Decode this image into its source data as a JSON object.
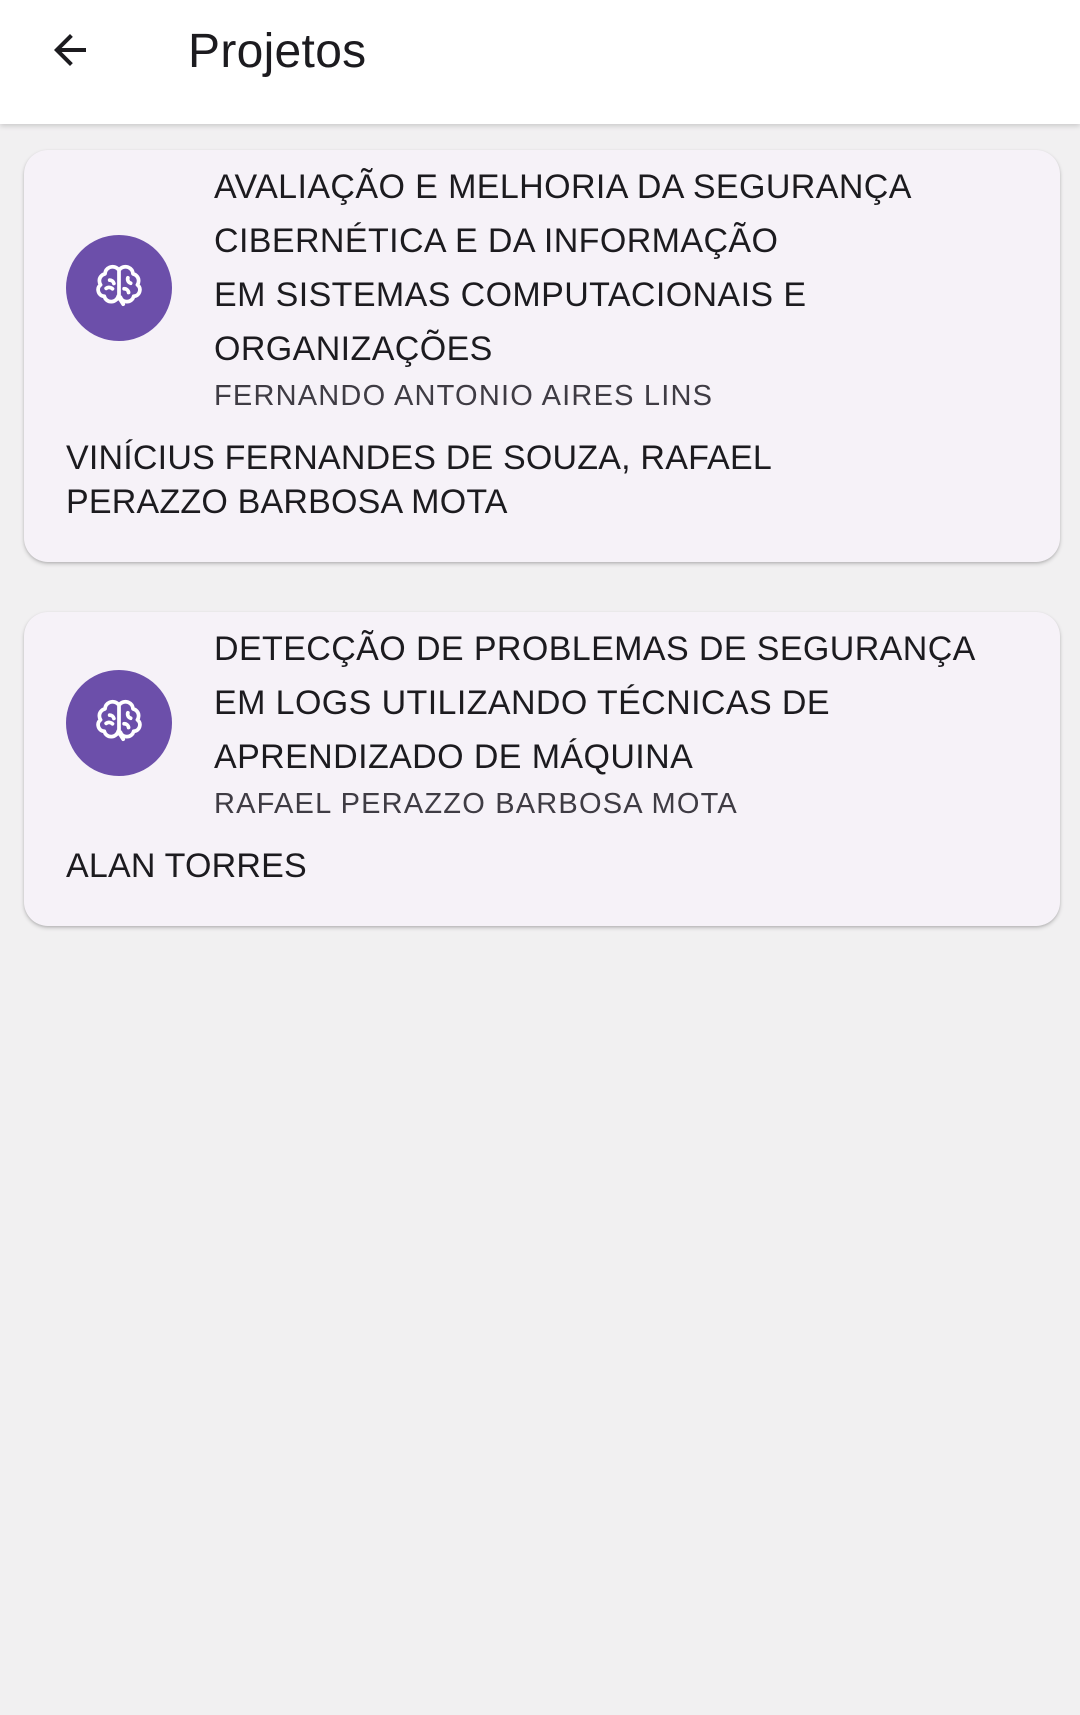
{
  "appbar": {
    "back_icon": "arrow-left-icon",
    "title": "Projetos"
  },
  "projects": [
    {
      "icon": "brain-icon",
      "title": "AVALIAÇÃO E MELHORIA DA SEGURANÇA\nCIBERNÉTICA E DA INFORMAÇÃO\nEM SISTEMAS COMPUTACIONAIS E\nORGANIZAÇÕES",
      "advisor": "FERNANDO ANTONIO AIRES LINS",
      "members": "VINÍCIUS FERNANDES DE SOUZA, RAFAEL PERAZZO BARBOSA MOTA"
    },
    {
      "icon": "brain-icon",
      "title": "DETECÇÃO DE PROBLEMAS DE SEGURANÇA\nEM LOGS UTILIZANDO TÉCNICAS DE\nAPRENDIZADO DE  MÁQUINA",
      "advisor": "RAFAEL PERAZZO BARBOSA MOTA",
      "members": "ALAN TORRES"
    }
  ],
  "colors": {
    "accent": "#6c4faa",
    "card_background": "#f6f2f8",
    "page_background": "#f1f0f1"
  }
}
